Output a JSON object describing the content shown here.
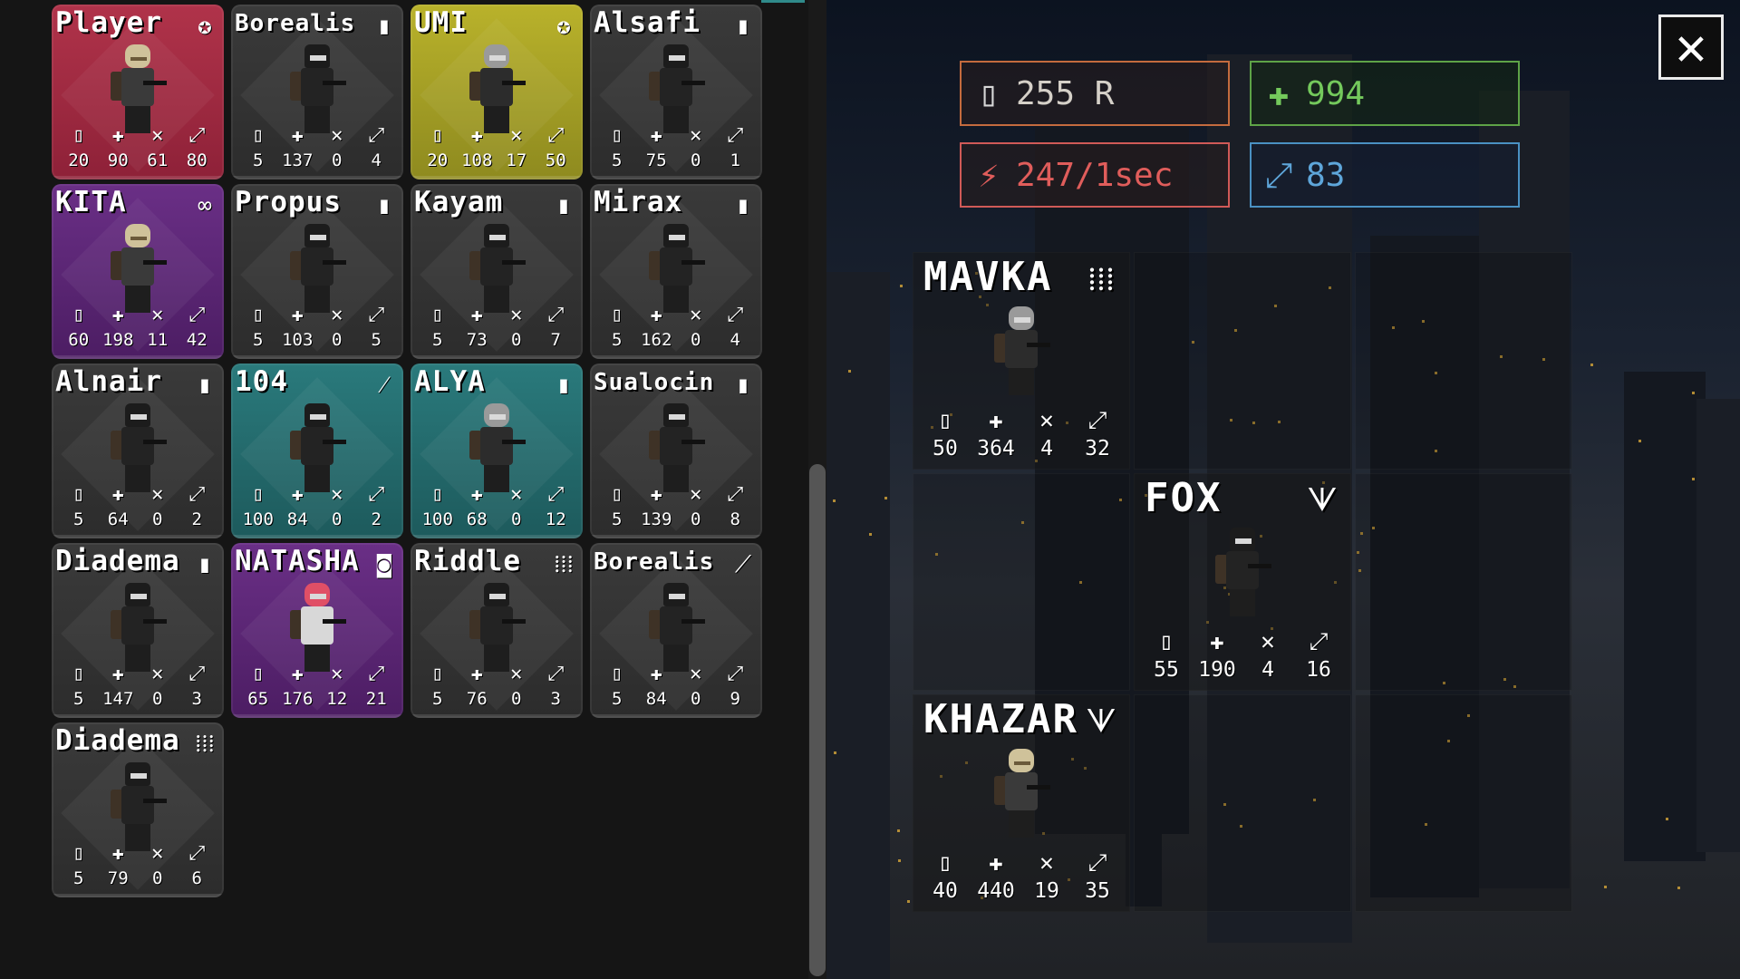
{
  "roster": [
    {
      "name": "Player",
      "cls_icon": "star-badge-icon",
      "cls_glyph": "✪",
      "bg": "red",
      "sprite": "girl",
      "stats": [
        "20",
        "90",
        "61",
        "80"
      ]
    },
    {
      "name": "Borealis",
      "cls_icon": "ammo-clip-icon",
      "cls_glyph": "▮",
      "bg": "grey",
      "sprite": "soldier",
      "stats": [
        "5",
        "137",
        "0",
        "4"
      ]
    },
    {
      "name": "UMI",
      "cls_icon": "star-badge-icon",
      "cls_glyph": "✪",
      "bg": "yellow",
      "sprite": "grey",
      "stats": [
        "20",
        "108",
        "17",
        "50"
      ]
    },
    {
      "name": "Alsafi",
      "cls_icon": "ammo-clip-icon",
      "cls_glyph": "▮",
      "bg": "grey",
      "sprite": "soldier",
      "stats": [
        "5",
        "75",
        "0",
        "1"
      ]
    },
    {
      "name": "KITA",
      "cls_icon": "binoculars-icon",
      "cls_glyph": "∞",
      "bg": "purple",
      "sprite": "girl",
      "stats": [
        "60",
        "198",
        "11",
        "42"
      ]
    },
    {
      "name": "Propus",
      "cls_icon": "ammo-clip-icon",
      "cls_glyph": "▮",
      "bg": "grey",
      "sprite": "soldier",
      "stats": [
        "5",
        "103",
        "0",
        "5"
      ]
    },
    {
      "name": "Kayam",
      "cls_icon": "ammo-clip-icon",
      "cls_glyph": "▮",
      "bg": "grey",
      "sprite": "soldier",
      "stats": [
        "5",
        "73",
        "0",
        "7"
      ]
    },
    {
      "name": "Mirax",
      "cls_icon": "ammo-clip-icon",
      "cls_glyph": "▮",
      "bg": "grey",
      "sprite": "soldier",
      "stats": [
        "5",
        "162",
        "0",
        "4"
      ]
    },
    {
      "name": "Alnair",
      "cls_icon": "ammo-clip-icon",
      "cls_glyph": "▮",
      "bg": "grey",
      "sprite": "soldier",
      "stats": [
        "5",
        "64",
        "0",
        "2"
      ]
    },
    {
      "name": "104",
      "cls_icon": "syringe-icon",
      "cls_glyph": "⁄",
      "bg": "teal",
      "sprite": "soldier",
      "stats": [
        "100",
        "84",
        "0",
        "2"
      ]
    },
    {
      "name": "ALYA",
      "cls_icon": "ammo-clip-icon",
      "cls_glyph": "▮",
      "bg": "teal",
      "sprite": "grey",
      "stats": [
        "100",
        "68",
        "0",
        "12"
      ]
    },
    {
      "name": "Sualocin",
      "cls_icon": "ammo-clip-icon",
      "cls_glyph": "▮",
      "bg": "grey",
      "sprite": "soldier",
      "stats": [
        "5",
        "139",
        "0",
        "8"
      ]
    },
    {
      "name": "Diadema",
      "cls_icon": "ammo-clip-icon",
      "cls_glyph": "▮",
      "bg": "grey",
      "sprite": "soldier",
      "stats": [
        "5",
        "147",
        "0",
        "3"
      ]
    },
    {
      "name": "NATASHA",
      "cls_icon": "grenade-icon",
      "cls_glyph": "◙",
      "bg": "purple",
      "sprite": "pink",
      "stats": [
        "65",
        "176",
        "12",
        "21"
      ]
    },
    {
      "name": "Riddle",
      "cls_icon": "bullets-icon",
      "cls_glyph": "⁞⁞⁞",
      "bg": "grey",
      "sprite": "soldier",
      "stats": [
        "5",
        "76",
        "0",
        "3"
      ]
    },
    {
      "name": "Borealis",
      "cls_icon": "rifle-icon",
      "cls_glyph": "⟋",
      "bg": "grey",
      "sprite": "soldier",
      "stats": [
        "5",
        "84",
        "0",
        "9"
      ]
    },
    {
      "name": "Diadema",
      "cls_icon": "bullets-icon",
      "cls_glyph": "⁞⁞⁞",
      "bg": "grey",
      "sprite": "soldier",
      "stats": [
        "5",
        "79",
        "0",
        "6"
      ]
    }
  ],
  "stat_icons": [
    {
      "name": "radio-icon",
      "glyph": "▯"
    },
    {
      "name": "medkit-icon",
      "glyph": "✚"
    },
    {
      "name": "damage-icon",
      "glyph": "✕"
    },
    {
      "name": "range-icon",
      "glyph": "⤢"
    }
  ],
  "resources": {
    "radio": {
      "icon": "radio-icon",
      "glyph": "▯",
      "value": "255 R"
    },
    "med": {
      "icon": "medkit-icon",
      "glyph": "✚",
      "value": "994"
    },
    "dps": {
      "icon": "damage-icon",
      "glyph": "⚡",
      "value": "247/1sec"
    },
    "range": {
      "icon": "range-icon",
      "glyph": "⤢",
      "value": "83"
    }
  },
  "squad": [
    {
      "name": "MAVKA",
      "cls_icon": "bullets-icon",
      "cls_glyph": "⁞⁞⁞",
      "sprite": "grey",
      "stats": [
        "50",
        "364",
        "4",
        "32"
      ]
    },
    {
      "name": "FOX",
      "cls_icon": "knives-icon",
      "cls_glyph": "ᗐ",
      "sprite": "soldier",
      "stats": [
        "55",
        "190",
        "4",
        "16"
      ]
    },
    {
      "name": "KHAZAR",
      "cls_icon": "knives-icon",
      "cls_glyph": "ᗐ",
      "sprite": "girl",
      "stats": [
        "40",
        "440",
        "19",
        "35"
      ]
    }
  ],
  "close_glyph": "✕",
  "colors": {
    "radio": "#c46b3e",
    "med": "#5ea347",
    "dps": "#d05a57",
    "range": "#4a91c3"
  }
}
